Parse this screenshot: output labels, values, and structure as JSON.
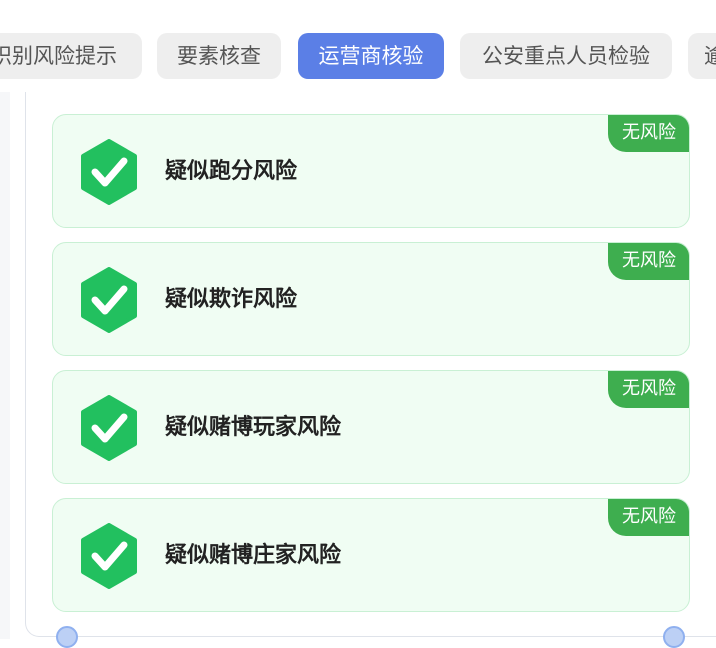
{
  "tabs": [
    {
      "label": "识别风险提示",
      "active": false
    },
    {
      "label": "要素核查",
      "active": false
    },
    {
      "label": "运营商核验",
      "active": true
    },
    {
      "label": "公安重点人员检验",
      "active": false
    },
    {
      "label": "逾",
      "active": false
    }
  ],
  "cards": [
    {
      "title": "疑似跑分风险",
      "badge": "无风险",
      "icon": "check-hexagon-icon"
    },
    {
      "title": "疑似欺诈风险",
      "badge": "无风险",
      "icon": "check-hexagon-icon"
    },
    {
      "title": "疑似赌博玩家风险",
      "badge": "无风险",
      "icon": "check-hexagon-icon"
    },
    {
      "title": "疑似赌博庄家风险",
      "badge": "无风险",
      "icon": "check-hexagon-icon"
    }
  ],
  "colors": {
    "accent": "#5b7fe6",
    "success": "#3eae4f",
    "icon_green": "#22c05f",
    "card_bg": "#f0fdf3"
  }
}
